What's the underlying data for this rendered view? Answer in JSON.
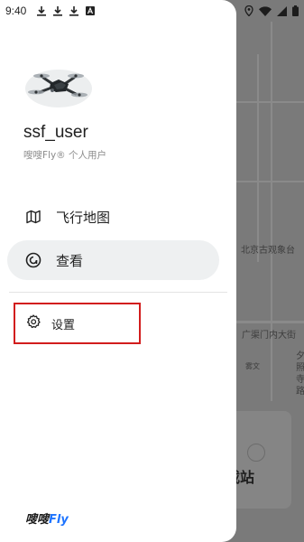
{
  "status_bar": {
    "time": "9:40",
    "icons": [
      "download-icon",
      "download-icon",
      "download-icon",
      "a-icon",
      "location-icon",
      "wifi-icon",
      "signal-icon",
      "battery-icon"
    ]
  },
  "drawer": {
    "username": "ssf_user",
    "subtitle": "嗖嗖Fly® 个人用户",
    "menu": [
      {
        "label": "飞行地图",
        "icon": "map-icon",
        "active": false
      },
      {
        "label": "查看",
        "icon": "view-icon",
        "active": true
      }
    ],
    "settings_label": "设置",
    "brand_main": "嗖嗖",
    "brand_accent": "Fly"
  },
  "map": {
    "labels": [
      "北京古观象台",
      "广渠门内大街",
      "夕",
      "照",
      "寺",
      "路",
      "雾文"
    ],
    "card_text": "载站"
  },
  "colors": {
    "highlight_border": "#d21d1d",
    "brand_accent": "#1e74ff",
    "active_bg": "#eef0f1"
  }
}
